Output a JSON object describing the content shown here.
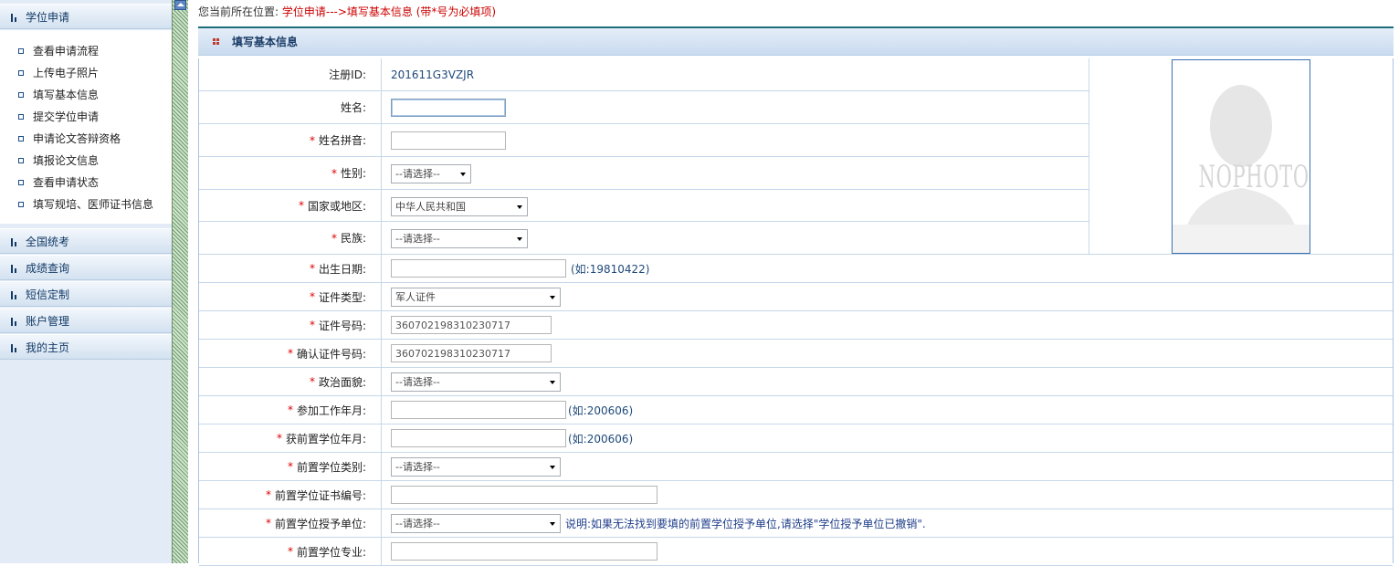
{
  "sidebar": {
    "sections": [
      {
        "label": "学位申请",
        "expanded": true
      },
      {
        "label": "全国统考"
      },
      {
        "label": "成绩查询"
      },
      {
        "label": "短信定制"
      },
      {
        "label": "账户管理"
      },
      {
        "label": "我的主页"
      }
    ],
    "items": [
      {
        "label": "查看申请流程"
      },
      {
        "label": "上传电子照片"
      },
      {
        "label": "填写基本信息"
      },
      {
        "label": "提交学位申请"
      },
      {
        "label": "申请论文答辩资格"
      },
      {
        "label": "填报论文信息"
      },
      {
        "label": "查看申请状态"
      },
      {
        "label": "填写规培、医师证书信息"
      }
    ],
    "collapse_icon": "triangle-up-icon"
  },
  "breadcrumb": {
    "prefix": "您当前所在位置:",
    "path": "学位申请--->填写基本信息 (带*号为必填项)"
  },
  "panel": {
    "title": "填写基本信息",
    "title_icon": "grid-dots-icon"
  },
  "photo": {
    "text": "NOPHOTO"
  },
  "form": {
    "required_mark": "*",
    "reg_id": {
      "label": "注册ID:",
      "value": "201611G3VZJR"
    },
    "name": {
      "label": "姓名:",
      "value": ""
    },
    "pinyin": {
      "label": "姓名拼音:",
      "value": ""
    },
    "gender": {
      "label": "性别:",
      "selected": "--请选择--"
    },
    "country": {
      "label": "国家或地区:",
      "selected": "中华人民共和国"
    },
    "ethnicity": {
      "label": "民族:",
      "selected": "--请选择--"
    },
    "birth_date": {
      "label": "出生日期:",
      "value": "",
      "hint": "(如:19810422)"
    },
    "id_type": {
      "label": "证件类型:",
      "selected": "军人证件"
    },
    "id_number": {
      "label": "证件号码:",
      "value": "360702198310230717"
    },
    "id_confirm": {
      "label": "确认证件号码:",
      "value": "360702198310230717"
    },
    "political": {
      "label": "政治面貌:",
      "selected": "--请选择--"
    },
    "work_start": {
      "label": "参加工作年月:",
      "value": "",
      "hint": "(如:200606)"
    },
    "prev_degree_date": {
      "label": "获前置学位年月:",
      "value": "",
      "hint": "(如:200606)"
    },
    "prev_degree_type": {
      "label": "前置学位类别:",
      "selected": "--请选择--"
    },
    "prev_cert_no": {
      "label": "前置学位证书编号:",
      "value": ""
    },
    "prev_unit": {
      "label": "前置学位授予单位:",
      "selected": "--请选择--",
      "note": "说明:如果无法找到要填的前置学位授予单位,请选择\"学位授予单位已撤销\"."
    },
    "prev_major": {
      "label": "前置学位专业:",
      "value": ""
    }
  },
  "colors": {
    "sidebar_bg": "#e3ecf6",
    "panel_header": "#c9dbef",
    "required": "#e00000",
    "breadcrumb_path": "#cc0000"
  }
}
